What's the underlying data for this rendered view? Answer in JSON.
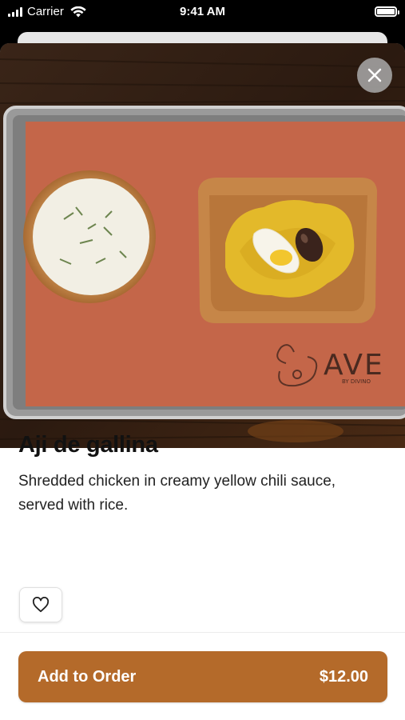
{
  "status_bar": {
    "carrier": "Carrier",
    "time": "9:41 AM"
  },
  "hero_image": {
    "alt": "Tray with rice bowl and aji de gallina",
    "logo_text": "AVE",
    "logo_subtext": "BY DIVINO"
  },
  "icons": {
    "close": "close-icon",
    "favorite": "heart-outline-icon"
  },
  "dish": {
    "title": "Aji de gallina",
    "description": "Shredded chicken in creamy yellow chili sauce, served with rice."
  },
  "order": {
    "add_label": "Add to Order",
    "price": "$12.00"
  },
  "colors": {
    "accent": "#b46a2a",
    "tray_paper": "#c96a4c"
  }
}
